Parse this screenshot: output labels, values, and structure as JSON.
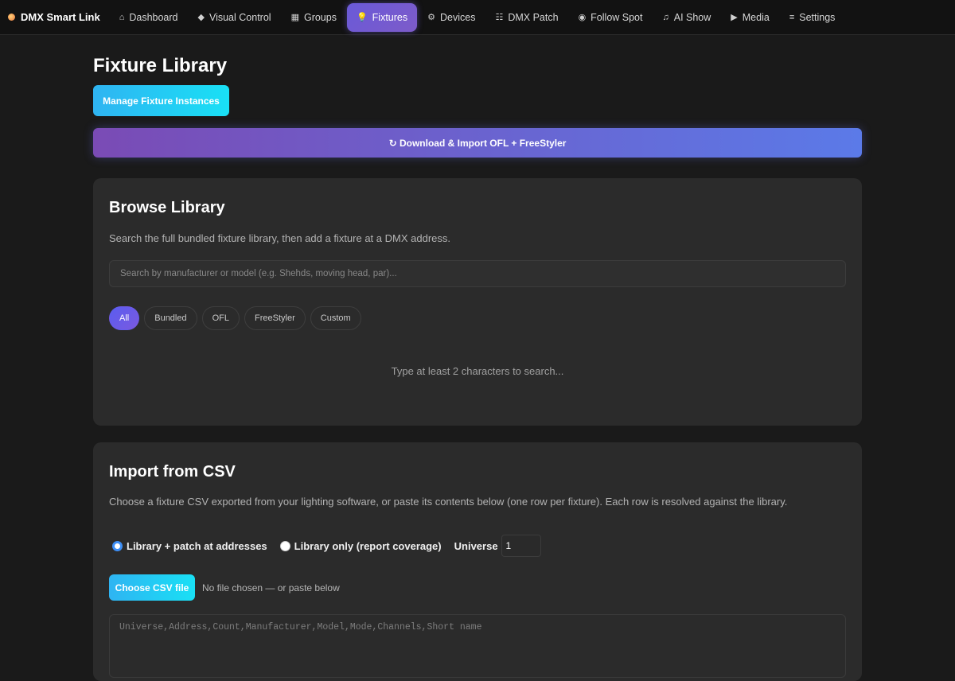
{
  "nav": {
    "brand": "DMX Smart Link",
    "items": [
      {
        "icon": "⌂",
        "label": "Dashboard"
      },
      {
        "icon": "◆",
        "label": "Visual Control"
      },
      {
        "icon": "▦",
        "label": "Groups"
      },
      {
        "icon": "💡",
        "label": "Fixtures"
      },
      {
        "icon": "⚙",
        "label": "Devices"
      },
      {
        "icon": "☷",
        "label": "DMX Patch"
      },
      {
        "icon": "◉",
        "label": "Follow Spot"
      },
      {
        "icon": "♫",
        "label": "AI Show"
      },
      {
        "icon": "▶",
        "label": "Media"
      },
      {
        "icon": "≡",
        "label": "Settings"
      }
    ],
    "active": "Fixtures"
  },
  "page": {
    "title": "Fixture Library",
    "manage_button": "Manage Fixture Instances",
    "download_button": "↻ Download & Import OFL + FreeStyler"
  },
  "browse": {
    "title": "Browse Library",
    "description": "Search the full bundled fixture library, then add a fixture at a DMX address.",
    "search_placeholder": "Search by manufacturer or model (e.g. Shehds, moving head, par)...",
    "filters": [
      "All",
      "Bundled",
      "OFL",
      "FreeStyler",
      "Custom"
    ],
    "active_filter": "All",
    "empty_message": "Type at least 2 characters to search..."
  },
  "csv": {
    "title": "Import from CSV",
    "description": "Choose a fixture CSV exported from your lighting software, or paste its contents below (one row per fixture). Each row is resolved against the library.",
    "mode_patch": "Library + patch at addresses",
    "mode_report": "Library only (report coverage)",
    "universe_label": "Universe",
    "universe_value": "1",
    "file_button": "Choose CSV file",
    "file_status": "No file chosen — or paste below",
    "textarea_placeholder": "Universe,Address,Count,Manufacturer,Model,Mode,Channels,Short name"
  },
  "colors": {
    "accent_purple": "#6a5ad8",
    "accent_cyan": "#19e0f5",
    "background": "#1a1a1a",
    "card": "#2b2b2b"
  }
}
